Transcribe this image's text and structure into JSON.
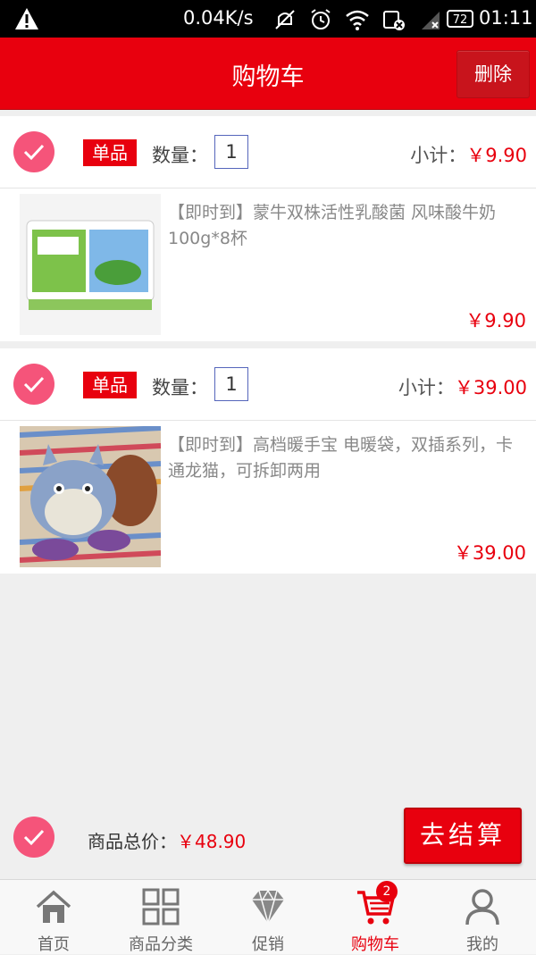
{
  "status_bar": {
    "network_speed": "0.04K/s",
    "battery": "72",
    "time": "01:11"
  },
  "header": {
    "title": "购物车",
    "delete_label": "删除"
  },
  "items": [
    {
      "tag": "单品",
      "qty_label": "数量：",
      "qty": "1",
      "subtotal_label": "小计：",
      "subtotal": "￥9.90",
      "name": "【即时到】蒙牛双株活性乳酸菌 风味酸牛奶100g*8杯",
      "price": "￥9.90"
    },
    {
      "tag": "单品",
      "qty_label": "数量：",
      "qty": "1",
      "subtotal_label": "小计：",
      "subtotal": "￥39.00",
      "name": "【即时到】高档暖手宝 电暖袋，双插系列，卡通龙猫，可拆卸两用",
      "price": "￥39.00"
    }
  ],
  "footer": {
    "total_label": "商品总价：",
    "total": "￥48.90",
    "checkout_label": "去结算"
  },
  "nav": {
    "items": [
      {
        "label": "首页",
        "icon": "home-icon"
      },
      {
        "label": "商品分类",
        "icon": "grid-icon"
      },
      {
        "label": "促销",
        "icon": "diamond-icon"
      },
      {
        "label": "购物车",
        "icon": "cart-icon"
      },
      {
        "label": "我的",
        "icon": "user-icon"
      }
    ],
    "cart_badge": "2"
  },
  "colors": {
    "brand_red": "#e8000e",
    "check_pink": "#f5547a",
    "price_red": "#e8000e"
  }
}
